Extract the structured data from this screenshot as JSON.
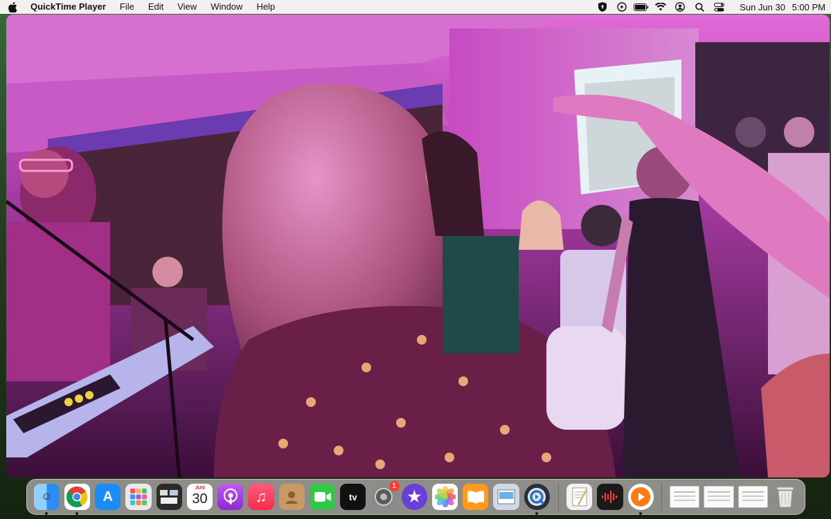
{
  "menubar": {
    "apple_icon": "apple-logo-icon",
    "app_name": "QuickTime Player",
    "menus": [
      "File",
      "Edit",
      "View",
      "Window",
      "Help"
    ],
    "status_icons": [
      "vpn-shield-icon",
      "play-circle-icon",
      "battery-icon",
      "wifi-icon",
      "user-icon",
      "search-icon",
      "control-center-icon"
    ],
    "clock": {
      "date": "Sun Jun 30",
      "time": "5:00 PM"
    }
  },
  "video": {
    "description_icon": "video-frame-party-scene"
  },
  "dock": {
    "apps": [
      {
        "name": "Finder",
        "icon": "finder-icon",
        "color": "#2c8cf0",
        "running": true
      },
      {
        "name": "Chrome",
        "icon": "chrome-icon",
        "color": "#ffffff",
        "running": true
      },
      {
        "name": "App Store",
        "icon": "app-store-icon",
        "color": "#1b8cf6",
        "running": false
      },
      {
        "name": "Launchpad",
        "icon": "launchpad-icon",
        "color": "#e8e8ee",
        "running": false
      },
      {
        "name": "Mission Control",
        "icon": "mission-control-icon",
        "color": "#2a2a2a",
        "running": false
      },
      {
        "name": "Calendar",
        "icon": "calendar-icon",
        "color": "#ffffff",
        "month": "JUN",
        "day": "30",
        "running": false
      },
      {
        "name": "Podcasts",
        "icon": "podcasts-icon",
        "color": "#a13ce0",
        "running": false
      },
      {
        "name": "Music",
        "icon": "music-icon",
        "color": "#fa3c55",
        "running": false
      },
      {
        "name": "Contacts",
        "icon": "contacts-icon",
        "color": "#c79a63",
        "running": false
      },
      {
        "name": "FaceTime",
        "icon": "facetime-icon",
        "color": "#33c748",
        "running": false
      },
      {
        "name": "TV",
        "icon": "apple-tv-icon",
        "color": "#111111",
        "label": "tv",
        "running": false
      },
      {
        "name": "System Settings",
        "icon": "system-settings-icon",
        "color": "#8a8a8a",
        "badge": "1",
        "running": false
      },
      {
        "name": "iMovie",
        "icon": "imovie-icon",
        "color": "#6a3fd8",
        "running": false
      },
      {
        "name": "Photos",
        "icon": "photos-icon",
        "color": "#ffffff",
        "running": false
      },
      {
        "name": "Books",
        "icon": "books-icon",
        "color": "#ff9a1c",
        "running": false
      },
      {
        "name": "Preview",
        "icon": "preview-icon",
        "color": "#cfd8e4",
        "running": false
      },
      {
        "name": "QuickTime Player",
        "icon": "quicktime-icon",
        "color": "#2a2f3a",
        "running": true
      }
    ],
    "apps2": [
      {
        "name": "TextEdit",
        "icon": "textedit-icon",
        "color": "#f2f2f2",
        "running": false
      },
      {
        "name": "Voice Memos",
        "icon": "voice-memos-icon",
        "color": "#1a1a1a",
        "running": false
      },
      {
        "name": "Infuse",
        "icon": "infuse-icon",
        "color": "#ff7a12",
        "running": true
      }
    ],
    "windows": [
      "window-thumbnail-1",
      "window-thumbnail-2",
      "window-thumbnail-3"
    ],
    "trash": {
      "name": "Trash",
      "icon": "trash-icon"
    }
  }
}
